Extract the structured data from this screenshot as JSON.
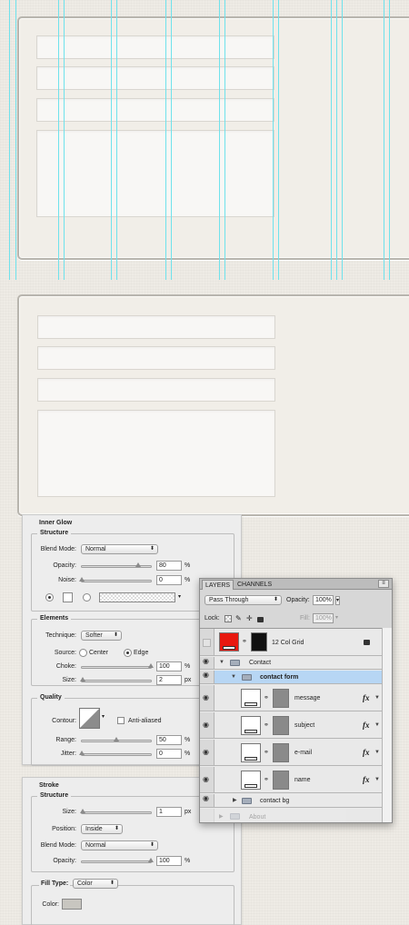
{
  "inner_glow": {
    "title": "Inner Glow",
    "structure_label": "Structure",
    "blend_mode_label": "Blend Mode:",
    "blend_mode_value": "Normal",
    "opacity_label": "Opacity:",
    "opacity_value": "80",
    "opacity_fraction": 0.8,
    "noise_label": "Noise:",
    "noise_value": "0",
    "percent": "%",
    "elements_label": "Elements",
    "technique_label": "Technique:",
    "technique_value": "Softer",
    "source_label": "Source:",
    "source_center": "Center",
    "source_edge": "Edge",
    "choke_label": "Choke:",
    "choke_value": "100",
    "size_label": "Size:",
    "size_value": "2",
    "px": "px",
    "quality_label": "Quality",
    "contour_label": "Contour:",
    "anti_aliased_label": "Anti-aliased",
    "range_label": "Range:",
    "range_value": "50",
    "jitter_label": "Jitter:",
    "jitter_value": "0"
  },
  "stroke": {
    "title": "Stroke",
    "structure_label": "Structure",
    "size_label": "Size:",
    "size_value": "1",
    "px": "px",
    "position_label": "Position:",
    "position_value": "Inside",
    "blend_mode_label": "Blend Mode:",
    "blend_mode_value": "Normal",
    "opacity_label": "Opacity:",
    "opacity_value": "100",
    "percent": "%",
    "fill_type_label": "Fill Type:",
    "fill_type_value": "Color",
    "color_label": "Color:",
    "color_swatch": "#c8c6c0"
  },
  "layers_panel": {
    "tab_layers": "LAYERS",
    "tab_channels": "CHANNELS",
    "blend_mode": "Pass Through",
    "opacity_label": "Opacity:",
    "opacity_value": "100%",
    "lock_label": "Lock:",
    "fill_label": "Fill:",
    "fill_value": "100%",
    "layers": {
      "grid": "12 Col Grid",
      "contact": "Contact",
      "contact_form": "contact form",
      "message": "message",
      "subject": "subject",
      "email": "e-mail",
      "name": "name",
      "contact_bg": "contact bg",
      "about": "About"
    },
    "fx_label": "fx",
    "grid_swatch_color": "#e8180f",
    "selected_row_color": "#b7d6f4"
  },
  "colors": {
    "guide": "#6fe2ec",
    "frame": "#b8b5ae",
    "background": "#eeebe5"
  },
  "icons": {
    "eye": "eye-icon",
    "folder": "folder-icon",
    "chain": "chain-link-icon",
    "lock": "lock-icon",
    "dropdown": "chevron-down-icon",
    "menu": "panel-menu-icon"
  }
}
